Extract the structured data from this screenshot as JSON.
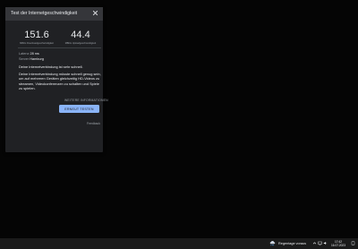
{
  "panel": {
    "title": "Test der Internetgeschwindigkeit",
    "download": {
      "value": "151.6",
      "label": "MBit/s Downloadgeschwindigkeit"
    },
    "upload": {
      "value": "44.4",
      "label": "MBit/s Uploadgeschwindigkeit"
    },
    "latency": {
      "label": "Latenz",
      "value": "28 ms"
    },
    "server": {
      "label": "Server",
      "value": "Hamburg"
    },
    "summary": "Deine Internetverbindung ist sehr schnell.",
    "description": "Deine Internetverbindung müsste schnell genug sein, um auf mehreren Geräten gleichzeitig HD-Videos zu streamen, Videokonferenzen zu schalten und Spiele zu spielen.",
    "more_info": "WEITERE INFORMATIONEN",
    "retest_button": "ERNEUT TESTEN",
    "feedback": "Feedback"
  },
  "taskbar": {
    "weather": "Regentage voraus",
    "time": "17:42",
    "date": "16.07.2023"
  },
  "colors": {
    "panel_bg": "#202124",
    "header_bg": "#35363a",
    "button_bg": "#8ab4f8",
    "desktop_bg": "#050505"
  }
}
